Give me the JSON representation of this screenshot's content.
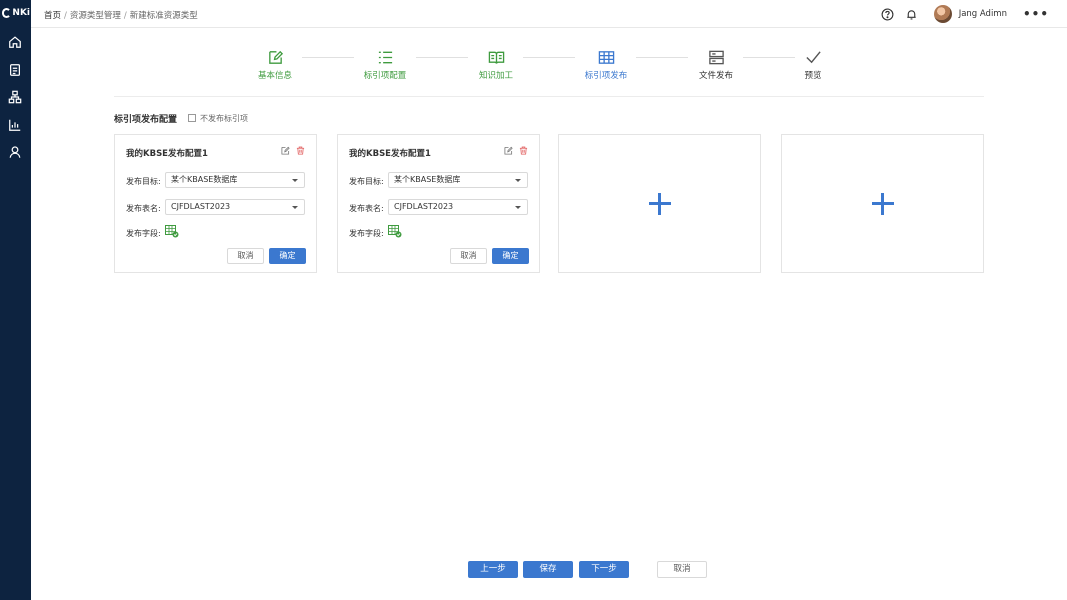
{
  "logo": {
    "text": "NKi"
  },
  "sidebar": {
    "items": [
      {
        "icon": "home-icon"
      },
      {
        "icon": "document-icon",
        "active": true
      },
      {
        "icon": "org-chart-icon"
      },
      {
        "icon": "bar-chart-icon"
      },
      {
        "icon": "user-icon"
      }
    ]
  },
  "breadcrumb": {
    "items": [
      "首页",
      "资源类型管理",
      "新建标准资源类型"
    ],
    "separator": "/"
  },
  "header": {
    "username": "Jang Adimn",
    "more": "•••"
  },
  "steps": [
    {
      "label": "基本信息",
      "status": "done",
      "icon": "edit-icon"
    },
    {
      "label": "标引项配置",
      "status": "done",
      "icon": "list-icon"
    },
    {
      "label": "知识加工",
      "status": "done",
      "icon": "book-icon"
    },
    {
      "label": "标引项发布",
      "status": "current",
      "icon": "table-icon"
    },
    {
      "label": "文件发布",
      "status": "todo",
      "icon": "server-icon"
    },
    {
      "label": "预览",
      "status": "todo",
      "icon": "check-icon"
    }
  ],
  "section": {
    "title": "标引项发布配置",
    "checkbox_label": "不发布标引项",
    "checkbox_checked": false
  },
  "cards": [
    {
      "title": "我的KBSE发布配置1",
      "target_label": "发布目标:",
      "target_value": "某个KBASE数据库",
      "table_label": "发布表名:",
      "table_value": "CJFDLAST2023",
      "field_label": "发布字段:",
      "cancel": "取消",
      "ok": "确定"
    },
    {
      "title": "我的KBSE发布配置1",
      "target_label": "发布目标:",
      "target_value": "某个KBASE数据库",
      "table_label": "发布表名:",
      "table_value": "CJFDLAST2023",
      "field_label": "发布字段:",
      "cancel": "取消",
      "ok": "确定"
    }
  ],
  "footer": {
    "prev": "上一步",
    "save": "保存",
    "next": "下一步",
    "cancel": "取消"
  },
  "colors": {
    "primary": "#3b78cf",
    "done": "#3f9b3f",
    "sidebar": "#0d2340",
    "delete": "#e05a5a"
  }
}
